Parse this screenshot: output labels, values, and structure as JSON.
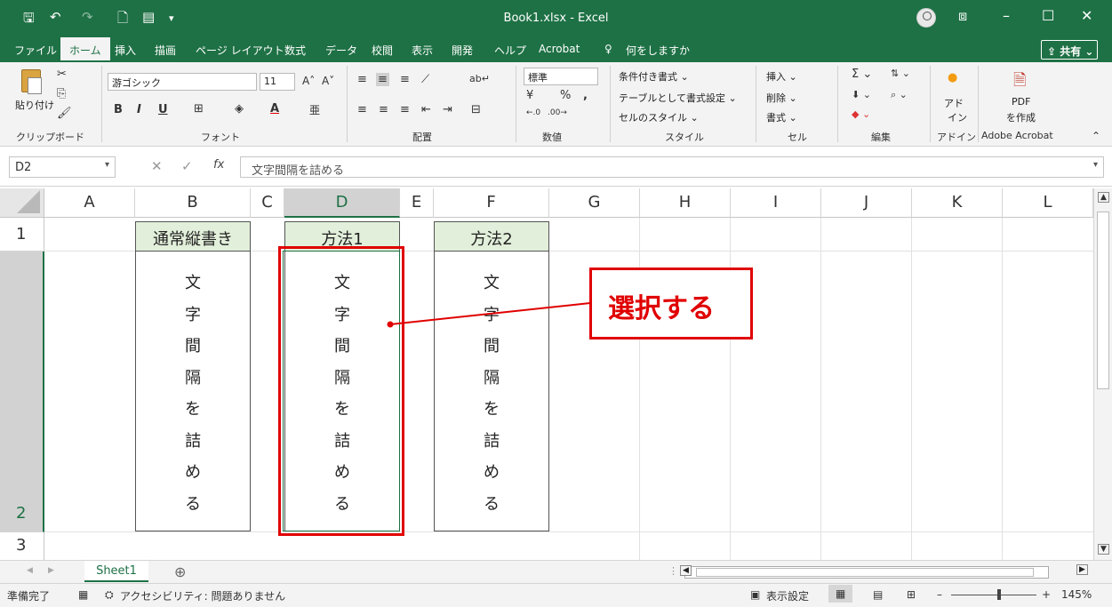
{
  "window": {
    "title": "Book1.xlsx  -  Excel",
    "qat": {
      "save": "🖫",
      "undo": "↶",
      "redo": "↷",
      "print_preview": "🗋",
      "form": "▤",
      "more": "▾"
    },
    "controls": {
      "ribbon_display": "⧈",
      "minimize": "–",
      "restore": "☐",
      "close": "✕"
    }
  },
  "menu": {
    "tabs": [
      "ファイル",
      "ホーム",
      "挿入",
      "描画",
      "ページ レイアウト",
      "数式",
      "データ",
      "校閲",
      "表示",
      "開発",
      "ヘルプ",
      "Acrobat"
    ],
    "active": "ホーム",
    "search_icon": "♀",
    "search_text": "何をしますか",
    "share_label": "⇪ 共有 ⌄"
  },
  "ribbon": {
    "clipboard": {
      "paste": "貼り付け",
      "cut": "✂",
      "copy": "⎘",
      "painter": "🖌",
      "group": "クリップボード"
    },
    "font": {
      "name": "游ゴシック",
      "size": "11",
      "grow": "A˄",
      "shrink": "A˅",
      "bold": "B",
      "italic": "I",
      "underline": "U",
      "border": "⊞",
      "fill": "◈",
      "color": "A",
      "phonetic": "亜",
      "group": "フォント"
    },
    "alignment": {
      "group": "配置",
      "wrap": "ab↵",
      "merge": "⊟"
    },
    "number": {
      "format": "標準",
      "percent": "%",
      "comma": ",",
      "currency": "¥",
      "inc": "←.0",
      "dec": ".00→",
      "group": "数値"
    },
    "styles": {
      "conditional": "条件付き書式 ⌄",
      "table": "テーブルとして書式設定 ⌄",
      "cell": "セルのスタイル ⌄",
      "group": "スタイル"
    },
    "cells": {
      "insert": "挿入 ⌄",
      "delete": "削除 ⌄",
      "format": "書式 ⌄",
      "group": "セル"
    },
    "editing": {
      "sum": "Σ ⌄",
      "sort": "⇅ ⌄",
      "find": "⌕ ⌄",
      "fill": "⬇ ⌄",
      "clear": "◆ ⌄",
      "group": "編集"
    },
    "addins": {
      "label1": "アド",
      "label2": "イン",
      "group": "アドイン"
    },
    "acrobat": {
      "label1": "PDF",
      "label2": "を作成",
      "group": "Adobe Acrobat"
    },
    "collapse": "⌃"
  },
  "formula_bar": {
    "name_box": "D2",
    "cancel": "✕",
    "enter": "✓",
    "fx": "fx",
    "content": "文字間隔を詰める"
  },
  "grid": {
    "columns": [
      "A",
      "B",
      "C",
      "D",
      "E",
      "F",
      "G",
      "H",
      "I",
      "J",
      "K",
      "L"
    ],
    "selected_column": "D",
    "rows": [
      "1",
      "2",
      "3"
    ],
    "selected_row": "2",
    "headers": {
      "b1": "通常縦書き",
      "d1": "方法1",
      "f1": "方法2"
    },
    "vertical_text": [
      "文",
      "字",
      "間",
      "隔",
      "を",
      "詰",
      "め",
      "る"
    ]
  },
  "annotation": {
    "callout_text": "選択する",
    "color": "#e00000"
  },
  "sheets": {
    "tab": "Sheet1",
    "add": "⊕",
    "nav_prev": "◀",
    "nav_next": "▶"
  },
  "status": {
    "ready": "準備完了",
    "accessibility": "アクセシビリティ: 問題ありません",
    "display_settings": "表示設定",
    "zoom": "145%",
    "zoom_minus": "–",
    "zoom_plus": "+"
  },
  "colors": {
    "excel_green": "#1e7145",
    "header_fill": "#e2efda",
    "red": "#e00000"
  }
}
